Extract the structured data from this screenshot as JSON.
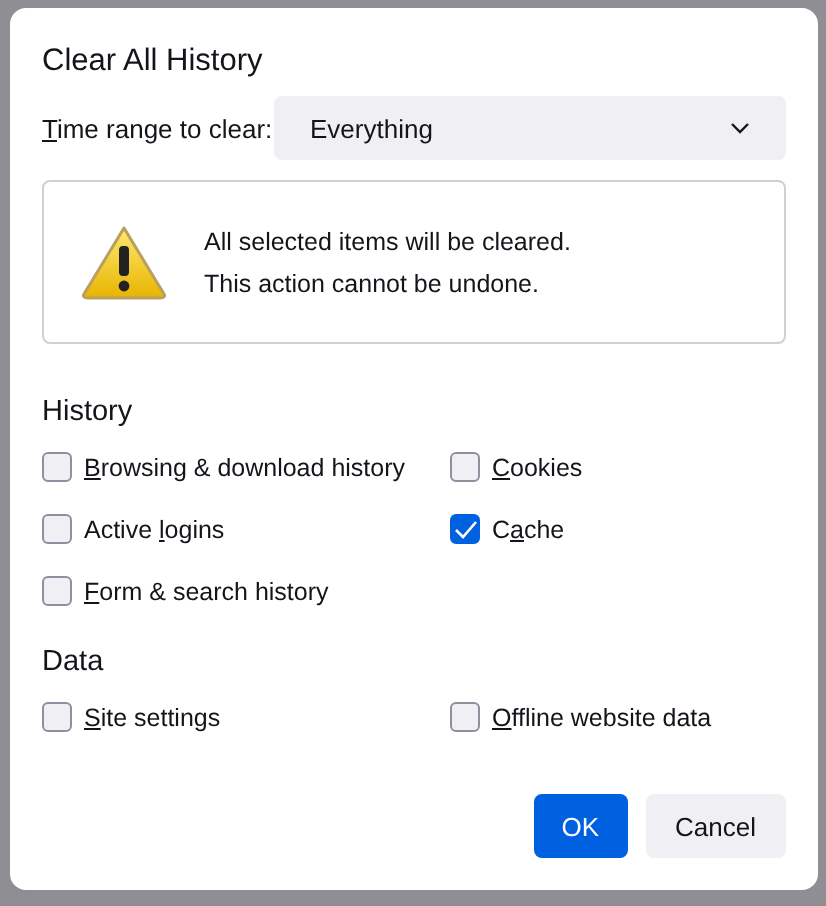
{
  "dialog": {
    "title": "Clear All History",
    "time_range": {
      "label_parts": [
        {
          "text": "T",
          "underlined": true
        },
        {
          "text": "ime range to clear:",
          "underlined": false
        }
      ],
      "value": "Everything"
    },
    "warning": {
      "lines": [
        "All selected items will be cleared.",
        "This action cannot be undone."
      ]
    },
    "sections": [
      {
        "heading": "History",
        "items": [
          {
            "label_parts": [
              {
                "text": "B",
                "underlined": true
              },
              {
                "text": "rowsing & download history",
                "underlined": false
              }
            ],
            "checked": false
          },
          {
            "label_parts": [
              {
                "text": "C",
                "underlined": true
              },
              {
                "text": "ookies",
                "underlined": false
              }
            ],
            "checked": false
          },
          {
            "label_parts": [
              {
                "text": "Active ",
                "underlined": false
              },
              {
                "text": "l",
                "underlined": true
              },
              {
                "text": "ogins",
                "underlined": false
              }
            ],
            "checked": false
          },
          {
            "label_parts": [
              {
                "text": "C",
                "underlined": false
              },
              {
                "text": "a",
                "underlined": true
              },
              {
                "text": "che",
                "underlined": false
              }
            ],
            "checked": true
          },
          {
            "label_parts": [
              {
                "text": "F",
                "underlined": true
              },
              {
                "text": "orm & search history",
                "underlined": false
              }
            ],
            "checked": false
          }
        ]
      },
      {
        "heading": "Data",
        "items": [
          {
            "label_parts": [
              {
                "text": "S",
                "underlined": true
              },
              {
                "text": "ite settings",
                "underlined": false
              }
            ],
            "checked": false
          },
          {
            "label_parts": [
              {
                "text": "O",
                "underlined": true
              },
              {
                "text": "ffline website data",
                "underlined": false
              }
            ],
            "checked": false
          }
        ]
      }
    ],
    "buttons": [
      {
        "label": "OK",
        "kind": "primary"
      },
      {
        "label": "Cancel",
        "kind": "secondary"
      }
    ]
  }
}
